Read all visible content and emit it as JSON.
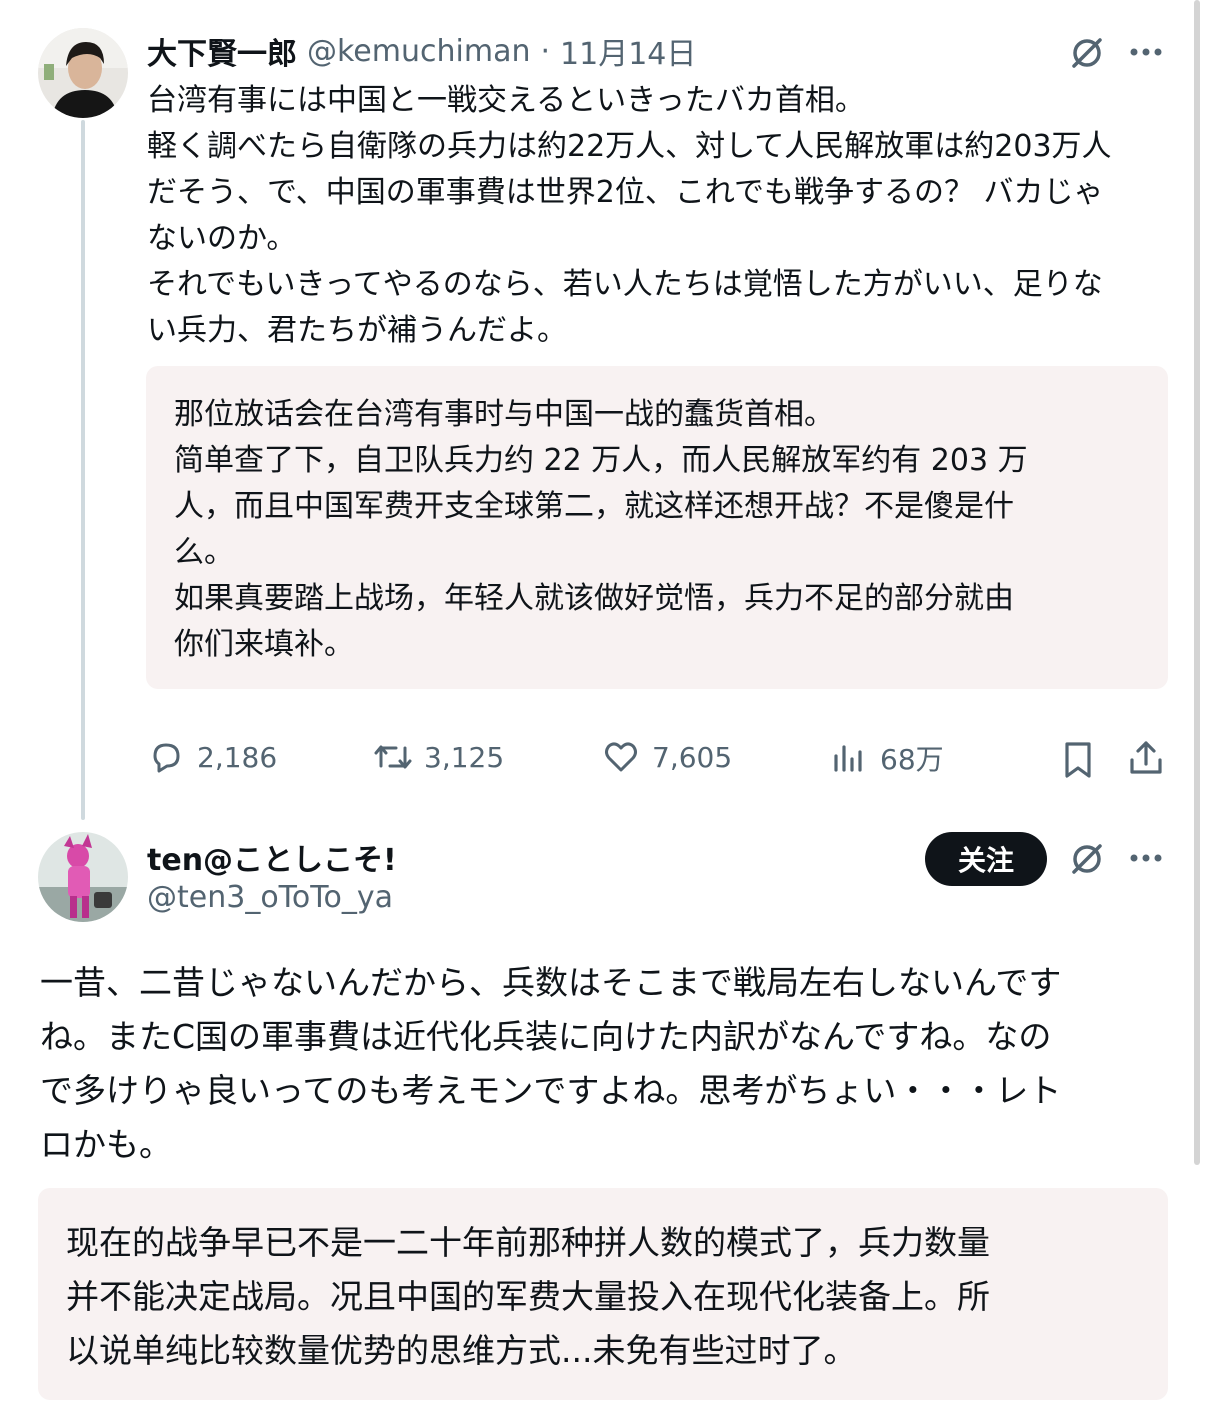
{
  "tweet1": {
    "display_name": "大下賢一郎",
    "handle": "@kemuchiman",
    "separator": "·",
    "date": "11月14日",
    "text": "台湾有事には中国と一戦交えるといきったバカ首相。\n軽く調べたら自衛隊の兵力は約22万人、対して人民解放軍は約203万人\nだそう、で、中国の軍事費は世界2位、これでも戦争するの？ バカじゃ\nないのか。\nそれでもいきってやるのなら、若い人たちは覚悟した方がいい、足りな\nい兵力、君たちが補うんだよ。",
    "translation": "那位放话会在台湾有事时与中国一战的蠢货首相。\n简单查了下，自卫队兵力约 22 万人，而人民解放军约有 203 万\n人，而且中国军费开支全球第二，就这样还想开战？不是傻是什\n么。\n如果真要踏上战场，年轻人就该做好觉悟，兵力不足的部分就由\n你们来填补。",
    "replies": "2,186",
    "retweets": "3,125",
    "likes": "7,605",
    "views": "68万"
  },
  "tweet2": {
    "display_name": "ten@ことしこそ!",
    "handle": "@ten3_oToTo_ya",
    "follow_label": "关注",
    "text": "一昔、二昔じゃないんだから、兵数はそこまで戦局左右しないんです\nね。またC国の軍事費は近代化兵装に向けた内訳がなんですね。なの\nで多けりゃ良いってのも考えモンですよね。思考がちょい・・・レト\nロかも。",
    "translation": "现在的战争早已不是一二十年前那种拼人数的模式了，兵力数量\n并不能决定战局。况且中国的军费大量投入在现代化装备上。所\n以说单纯比较数量优势的思维方式...未免有些过时了。"
  },
  "icons": [
    "grok-icon",
    "more-icon",
    "reply-icon",
    "retweet-icon",
    "like-icon",
    "views-icon",
    "bookmark-icon",
    "share-icon"
  ],
  "colors": {
    "text": "#0f1419",
    "secondary": "#536471",
    "translation_bg": "#f8f2f2",
    "follow_bg": "#0f1419"
  }
}
